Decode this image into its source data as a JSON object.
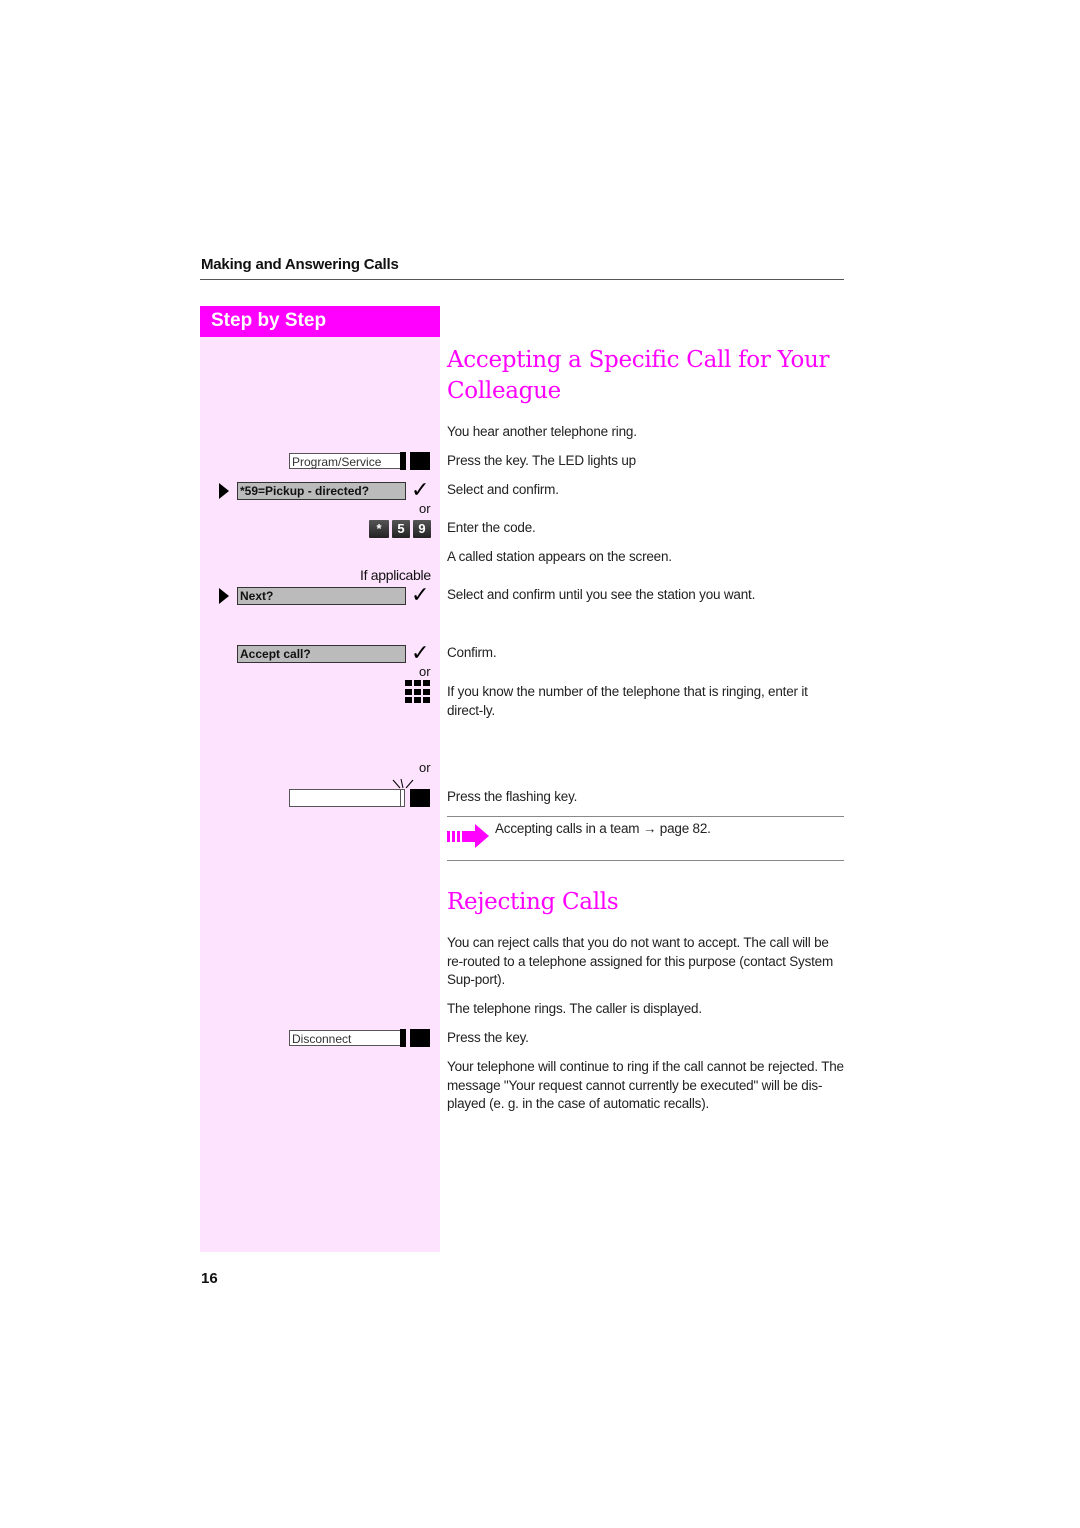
{
  "header": {
    "chapter_title": "Making and Answering Calls"
  },
  "sidebar": {
    "title": "Step by Step",
    "keys": {
      "program_service": "Program/Service",
      "disconnect": "Disconnect",
      "flashing_key": ""
    },
    "menu_items": {
      "pickup_directed": "*59=Pickup - directed?",
      "next": "Next?",
      "accept_call": "Accept call?"
    },
    "or_label": "or",
    "if_applicable": "If applicable",
    "dial_code": [
      "*",
      "5",
      "9"
    ]
  },
  "section1": {
    "title_line1": "Accepting a Specific Call for Your",
    "title_line2": "Colleague",
    "steps": [
      "You hear another telephone ring.",
      "Press the key. The LED lights up",
      "Select and confirm.",
      "Enter the code.",
      "A called station appears on the screen.",
      "Select and confirm until you see the station you want.",
      "Confirm.",
      "If you know the number of the telephone that is ringing, enter it direct-ly.",
      "Press the flashing key."
    ],
    "note": {
      "text": "Accepting calls in a team",
      "arrow": "→",
      "ref": "page 82."
    }
  },
  "section2": {
    "title": "Rejecting Calls",
    "paragraphs": [
      "You can reject calls that you do not want to accept. The call will be re-routed to a telephone assigned for this purpose (contact System Sup-port).",
      "The telephone rings. The caller is displayed.",
      "Press the key.",
      "Your telephone will continue to ring if the call cannot be rejected. The message \"Your request cannot currently be executed\" will be dis-played (e. g. in the case of automatic recalls)."
    ]
  },
  "footer": {
    "page_number": "16"
  },
  "colors": {
    "accent": "#ff00ff",
    "sidebar_bg": "#fde3fd"
  }
}
